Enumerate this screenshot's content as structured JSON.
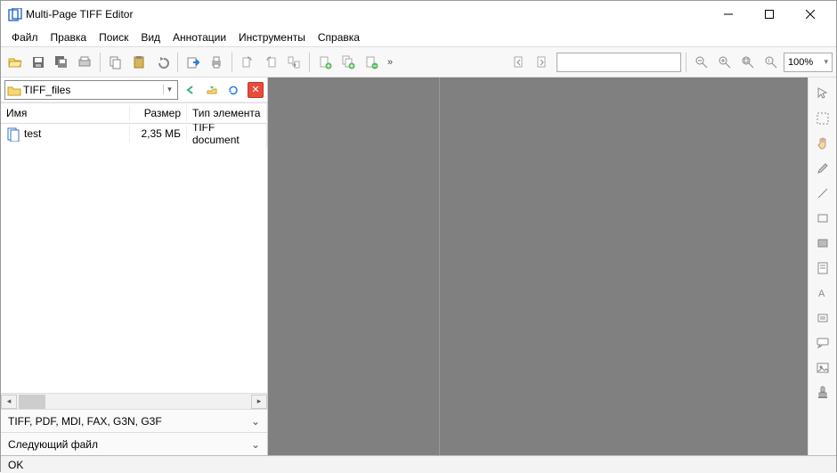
{
  "window": {
    "title": "Multi-Page TIFF Editor"
  },
  "menu": {
    "file": "Файл",
    "edit": "Правка",
    "search": "Поиск",
    "view": "Вид",
    "annotations": "Аннотации",
    "tools": "Инструменты",
    "help": "Справка"
  },
  "toolbar": {
    "zoom_value": "100%",
    "main_icons": [
      "open",
      "save",
      "save-all",
      "scan",
      "copy",
      "paste",
      "undo",
      "export",
      "print",
      "page-add",
      "page-delete",
      "page-extract",
      "crop-add",
      "crop-all",
      "crop-remove"
    ],
    "right_icons": [
      "page-prev",
      "page-next"
    ],
    "zoom_icons": [
      "zoom-out",
      "zoom-in",
      "zoom-fit",
      "zoom-actual"
    ]
  },
  "side_tools": [
    "pointer",
    "region-select",
    "hand",
    "pen",
    "line",
    "rect",
    "rect-filled",
    "note",
    "text",
    "highlight",
    "callout",
    "image",
    "stamp"
  ],
  "browser": {
    "path": "TIFF_files",
    "columns": {
      "name": "Имя",
      "size": "Размер",
      "type": "Тип элемента"
    },
    "rows": [
      {
        "name": "test",
        "size": "2,35 МБ",
        "type": "TIFF document"
      }
    ]
  },
  "filters": {
    "types": "TIFF, PDF, MDI, FAX, G3N, G3F",
    "next_file": "Следующий файл"
  },
  "status": {
    "text": "OK"
  },
  "colors": {
    "panel_gray": "#808080",
    "accent_blue": "#3673c2",
    "folder": "#e8b738"
  }
}
